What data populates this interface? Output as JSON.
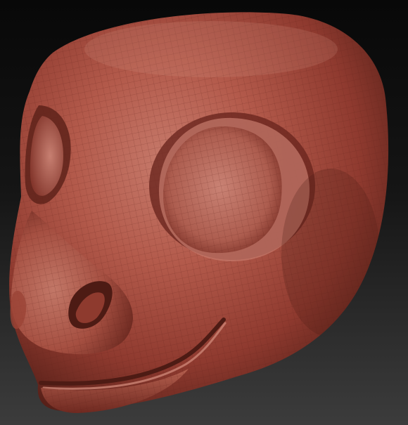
{
  "viewport": {
    "background_top": "#080808",
    "background_bottom": "#3c3c3c"
  },
  "model": {
    "kind": "sculpted creature head with polygon wireframe overlay",
    "material_base": "#a8493c",
    "material_dark": "#4d1b14",
    "material_highlight": "#d69a8d",
    "wire_color": "#6e2a21",
    "parts_visible": [
      "head",
      "left-eye-socket",
      "right-eye-socket",
      "nose",
      "nostril",
      "mouth",
      "lower-jaw"
    ]
  }
}
